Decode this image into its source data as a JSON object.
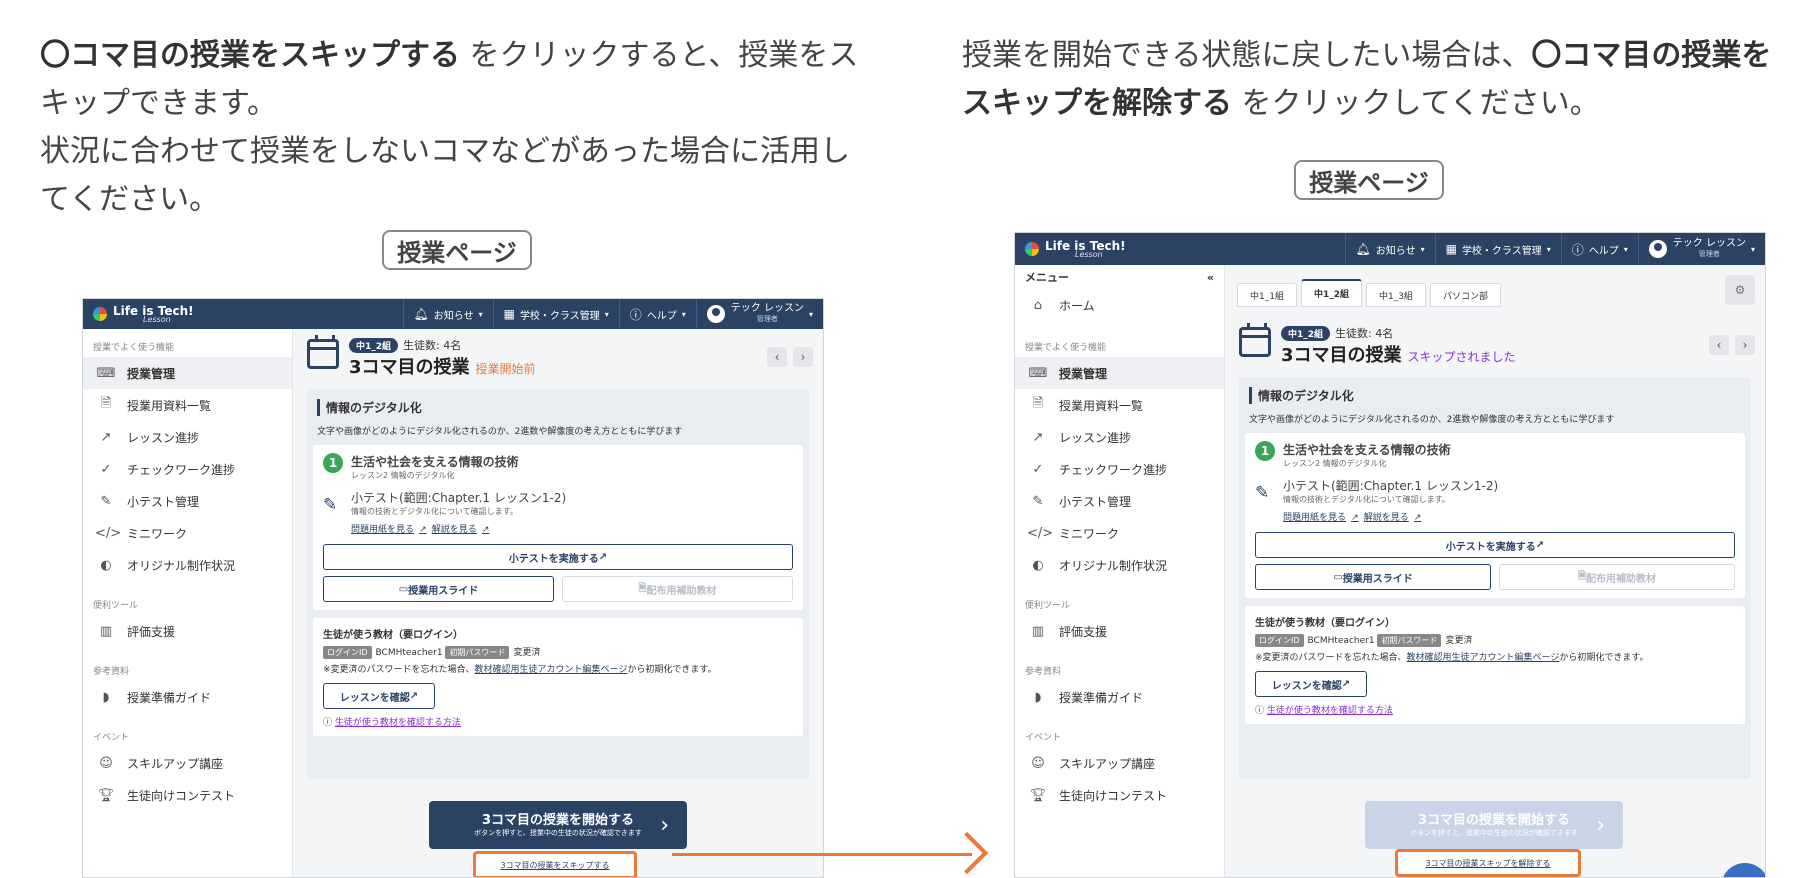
{
  "captions": {
    "left_bold": "〇コマ目の授業をスキップする",
    "left_rest": " をクリックすると、授業をスキップできます。",
    "left_line2": "状況に合わせて授業をしないコマなどがあった場合に活用してください。",
    "right_pre": "授業を開始できる状態に戻したい場合は、",
    "right_bold": "〇コマ目の授業をスキップを解除する",
    "right_post": " をクリックしてください。"
  },
  "page_pill": "授業ページ",
  "app": {
    "logo": "Life is Tech!",
    "logo_sub": "Lesson",
    "top": {
      "notice": "お知らせ",
      "school": "学校・クラス管理",
      "help": "ヘルプ",
      "user": "テック レッスン",
      "role": "管理者"
    },
    "menu_label": "メニュー",
    "home": "ホーム",
    "sections": {
      "common": "授業でよく使う機能",
      "tools": "便利ツール",
      "refs": "参考資料",
      "events": "イベント"
    },
    "nav": [
      "授業管理",
      "授業用資料一覧",
      "レッスン進捗",
      "チェックワーク進捗",
      "小テスト管理",
      "ミニワーク",
      "オリジナル制作状況"
    ],
    "nav_icons": [
      "terminal-icon",
      "document-icon",
      "trend-up-icon",
      "check-circle-icon",
      "pen-icon",
      "code-icon",
      "palette-icon"
    ],
    "tools": [
      "評価支援"
    ],
    "refs": [
      "授業準備ガイド"
    ],
    "events": [
      "スキルアップ講座",
      "生徒向けコンテスト"
    ],
    "tabs": [
      "中1_1組",
      "中1_2組",
      "中1_3組",
      "パソコン部"
    ],
    "class_badge": "中1_2組",
    "students": "生徒数: 4名",
    "lesson_title": "3コマ目の授業",
    "status_before": "授業開始前",
    "status_skipped": "スキップされました",
    "section_title": "情報のデジタル化",
    "section_desc": "文字や画像がどのようにデジタル化されるのか、2進数や解像度の考え方とともに学びます",
    "lesson_num": "1",
    "lesson_name": "生活や社会を支える情報の技術",
    "lesson_sub": "レッスン2  情報のデジタル化",
    "quiz_title": "小テスト(範囲:Chapter.1 レッスン1-2)",
    "quiz_desc": "情報の技術とデジタル化について確認します。",
    "quiz_link1": "問題用紙を見る",
    "quiz_link2": "解説を見る",
    "quiz_btn": "小テストを実施する",
    "slide_btn": "授業用スライド",
    "handout_btn": "配布用補助教材",
    "student_title": "生徒が使う教材（要ログイン）",
    "login_tag": "ログインID",
    "login_id": "BCMHteacher1",
    "pw_tag": "初期パスワード",
    "pw_val": "変更済",
    "pw_note_pre": "※変更済のパスワードを忘れた場合、",
    "pw_note_link": "教材確認用生徒アカウント編集ページ",
    "pw_note_post": "から初期化できます。",
    "check_btn": "レッスンを確認",
    "howto_link": "生徒が使う教材を確認する方法",
    "start_title": "3コマ目の授業を開始する",
    "start_sub": "ボタンを押すと、授業中の生徒の状況が確認できます",
    "skip_link": "3コマ目の授業をスキップする",
    "unskip_link": "3コマ目の授業スキップを解除する"
  },
  "colors": {
    "navy": "#2b4265",
    "orange": "#ec7936",
    "purple": "#8b2fd6",
    "green": "#3aa657"
  }
}
